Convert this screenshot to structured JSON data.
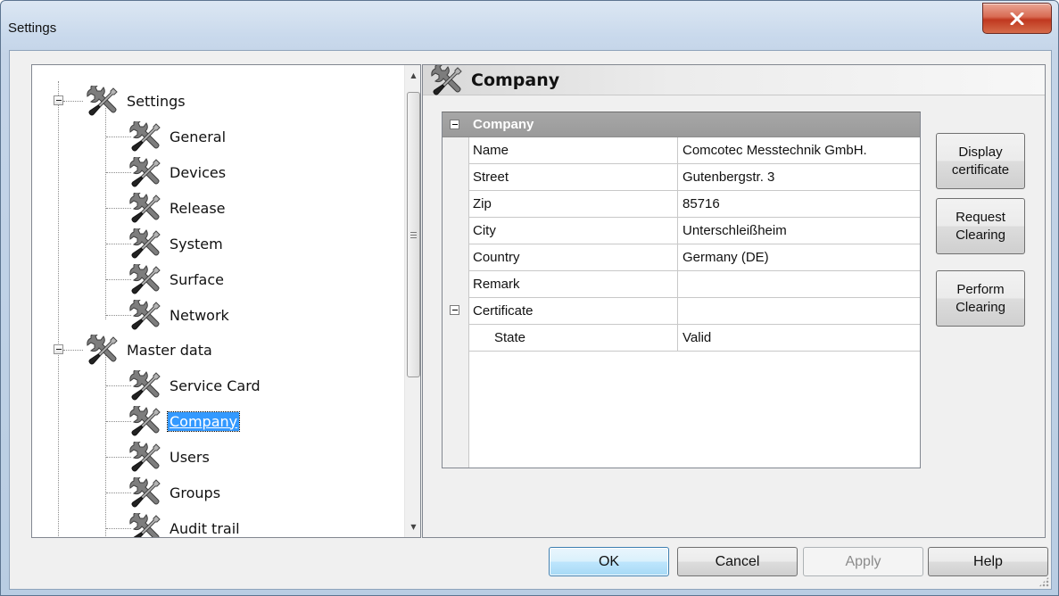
{
  "window": {
    "title": "Settings"
  },
  "tree": {
    "groups": [
      {
        "label": "Settings",
        "children": [
          "General",
          "Devices",
          "Release",
          "System",
          "Surface",
          "Network"
        ]
      },
      {
        "label": "Master data",
        "children": [
          "Service Card",
          "Company",
          "Users",
          "Groups",
          "Audit trail"
        ]
      }
    ],
    "selected": "Company"
  },
  "panel": {
    "title": "Company",
    "category": "Company",
    "rows": [
      {
        "key": "Name",
        "value": "Comcotec Messtechnik GmbH."
      },
      {
        "key": "Street",
        "value": "Gutenbergstr. 3"
      },
      {
        "key": "Zip",
        "value": "85716"
      },
      {
        "key": "City",
        "value": "Unterschleißheim"
      },
      {
        "key": "Country",
        "value": "Germany (DE)"
      },
      {
        "key": "Remark",
        "value": ""
      }
    ],
    "certificate_group": "Certificate",
    "certificate_rows": [
      {
        "key": "State",
        "value": "Valid"
      }
    ]
  },
  "side_buttons": {
    "display_certificate": "Display\ncertificate",
    "request_clearing": "Request\nClearing",
    "perform_clearing": "Perform\nClearing"
  },
  "footer": {
    "ok": "OK",
    "cancel": "Cancel",
    "apply": "Apply",
    "help": "Help"
  },
  "icons": {
    "tree_item": "tools-icon",
    "close": "close-icon"
  },
  "colors": {
    "selection": "#3399ff",
    "close_button": "#c0381f",
    "category_header": "#a7a7a7"
  }
}
